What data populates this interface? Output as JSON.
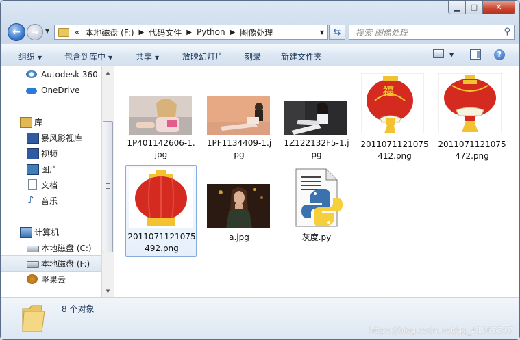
{
  "window": {
    "min_glyph": "▁",
    "max_glyph": "□",
    "close_glyph": "✕"
  },
  "address": {
    "overflow": "«",
    "crumbs": [
      "本地磁盘 (F:)",
      "代码文件",
      "Python",
      "图像处理"
    ]
  },
  "search": {
    "placeholder": "搜索 图像处理"
  },
  "toolbar": {
    "organize": "组织",
    "include_library": "包含到库中",
    "share": "共享",
    "slideshow": "放映幻灯片",
    "burn": "刻录",
    "new_folder": "新建文件夹"
  },
  "nav": {
    "autodesk": "Autodesk 360",
    "onedrive": "OneDrive",
    "libraries": "库",
    "storm": "暴风影视库",
    "videos": "视频",
    "pictures": "图片",
    "documents": "文档",
    "music": "音乐",
    "computer": "计算机",
    "drive_c": "本地磁盘 (C:)",
    "drive_f": "本地磁盘 (F:)",
    "nutstore": "坚果云"
  },
  "files": [
    {
      "name": "1P401142606-1.jpg",
      "kind": "photo"
    },
    {
      "name": "1PF1134409-1.jpg",
      "kind": "photo"
    },
    {
      "name": "1Z122132F5-1.jpg",
      "kind": "photo"
    },
    {
      "name": "2011071121075412.png",
      "kind": "lantern"
    },
    {
      "name": "2011071121075472.png",
      "kind": "lantern"
    },
    {
      "name": "2011071121075492.png",
      "kind": "lantern",
      "selected": true
    },
    {
      "name": "a.jpg",
      "kind": "photo"
    },
    {
      "name": "灰度.py",
      "kind": "python"
    }
  ],
  "display_names": {
    "f1": "1P401142606-1.\njpg",
    "f2": "1PF1134409-1.j\npg",
    "f3": "1Z122132F5-1.j\npg",
    "f4": "2011071121075\n412.png",
    "f5": "2011071121075\n472.png",
    "f6": "2011071121075\n492.png",
    "f7": "a.jpg",
    "f8": "灰度.py"
  },
  "details": {
    "count": "8 个对象"
  },
  "watermark": "https://blog.csdn.net/qq_41365597",
  "colors": {
    "accent": "#2a63b5",
    "lantern_red": "#d42a1f",
    "lantern_gold": "#f2c230"
  }
}
